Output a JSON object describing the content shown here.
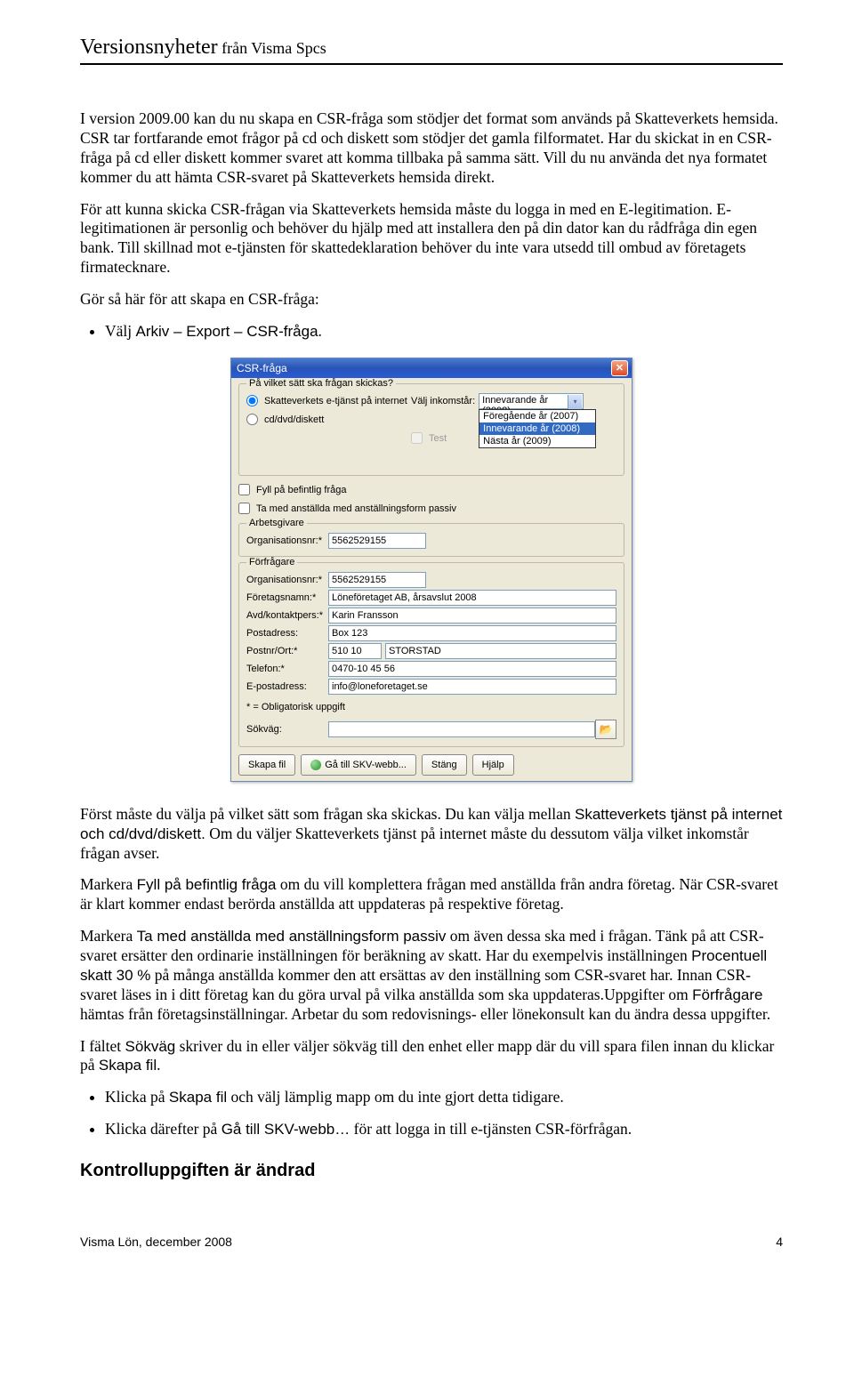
{
  "header": {
    "title": "Versionsnyheter",
    "from": " från Visma Spcs"
  },
  "paras": {
    "p1": "I version 2009.00 kan du nu skapa en CSR-fråga som stödjer det format som används på Skatteverkets hemsida. CSR tar fortfarande emot frågor på cd och diskett som stödjer det gamla filformatet. Har du skickat in en CSR-fråga på cd eller diskett kommer svaret att komma tillbaka på samma sätt. Vill du nu använda det nya formatet kommer du att hämta CSR-svaret på Skatteverkets hemsida direkt.",
    "p2": "För att kunna skicka CSR-frågan via Skatteverkets hemsida måste du logga in med en E-legitimation. E-legitimationen är personlig och behöver du hjälp med att installera den på din dator kan du rådfråga din egen bank. Till skillnad mot e-tjänsten för skattedeklaration behöver du inte vara utsedd till ombud av företagets firmatecknare.",
    "p3": "Gör så här för att skapa en CSR-fråga:",
    "p4a": "Först måste du välja på vilket sätt som frågan ska skickas. Du kan välja mellan ",
    "p4b_sans": "Skatteverkets tjänst på internet och cd/dvd/diskett.",
    "p4c": " Om du väljer Skatteverkets tjänst på internet måste du dessutom välja vilket inkomstår frågan avser.",
    "p5a": "Markera ",
    "p5b_sans": "Fyll på befintlig fråga",
    "p5c": " om du vill komplettera frågan med anställda från andra företag. När CSR-svaret är klart kommer endast berörda anställda att uppdateras på respektive företag.",
    "p6a": "Markera ",
    "p6b_sans": "Ta med anställda med anställningsform passiv",
    "p6c": " om även dessa ska med i frågan. Tänk på att CSR-svaret ersätter den ordinarie inställningen för beräkning av skatt. Har du exempelvis inställningen ",
    "p6d_sans": "Procentuell skatt 30 %",
    "p6e": " på många anställda kommer den att ersättas av den inställning som CSR-svaret har. Innan CSR-svaret läses in i ditt företag kan du göra urval på vilka anställda som ska uppdateras.Uppgifter om ",
    "p6f_sans": "Förfrågare",
    "p6g": " hämtas från företagsinställningar. Arbetar du som redovisnings- eller lönekonsult kan du ändra dessa uppgifter.",
    "p7a": "I fältet ",
    "p7b_sans": "Sökväg",
    "p7c": " skriver du in eller väljer sökväg till den enhet eller mapp där du vill spara filen innan du klickar på ",
    "p7d_sans": "Skapa fil",
    "p7e": "."
  },
  "bul1": {
    "li1a": "Välj ",
    "li1b_sans": "Arkiv – Export – CSR-fråga",
    "li1c": "."
  },
  "bul2": {
    "li1a": "Klicka på ",
    "li1b_sans": "Skapa fil",
    "li1c": " och välj lämplig mapp om du inte gjort detta tidigare.",
    "li2a": "Klicka därefter på ",
    "li2b_sans": "Gå till SKV-webb…",
    "li2c": " för att logga in till e-tjänsten CSR-förfrågan."
  },
  "dialog": {
    "title": "CSR-fråga",
    "grp1": {
      "title": "På vilket sätt ska frågan skickas?",
      "radio1": "Skatteverkets e-tjänst på internet",
      "radio2": "cd/dvd/diskett",
      "inkomstarLabel": "Välj inkomstår:",
      "selected": "Innevarande år (2008)",
      "options": [
        "Föregående år (2007)",
        "Innevarande år (2008)",
        "Nästa år (2009)"
      ],
      "test": "Test"
    },
    "chk1": "Fyll på befintlig fråga",
    "chk2": "Ta med anställda med anställningsform passiv",
    "grpArb": {
      "title": "Arbetsgivare",
      "orgLabel": "Organisationsnr:*",
      "org": "5562529155"
    },
    "grpFor": {
      "title": "Förfrågare",
      "orgLabel": "Organisationsnr:*",
      "org": "5562529155",
      "namnLabel": "Företagsnamn:*",
      "namn": "Löneföretaget AB, årsavslut 2008",
      "avdLabel": "Avd/kontaktpers:*",
      "avd": "Karin Fransson",
      "postadrLabel": "Postadress:",
      "postadr": "Box 123",
      "postnrLabel": "Postnr/Ort:*",
      "postnr": "510 10",
      "ort": "STORSTAD",
      "telLabel": "Telefon:*",
      "tel": "0470-10 45 56",
      "emailLabel": "E-postadress:",
      "email": "info@loneforetaget.se",
      "mandatory": "* = Obligatorisk uppgift",
      "sokvagLabel": "Sökväg:",
      "sokvag": ""
    },
    "buttons": {
      "skapa": "Skapa fil",
      "skv": "Gå till SKV-webb...",
      "stang": "Stäng",
      "hjalp": "Hjälp"
    }
  },
  "h2": "Kontrolluppgiften är ändrad",
  "footer": {
    "left": "Visma Lön, december 2008",
    "right": "4"
  }
}
